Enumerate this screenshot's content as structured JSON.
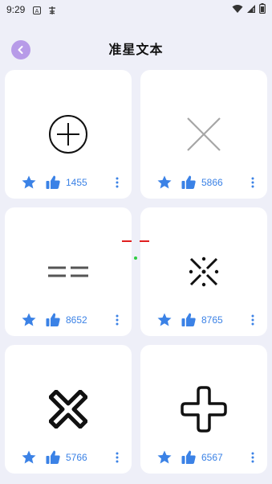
{
  "status_bar": {
    "time": "9:29"
  },
  "header": {
    "title": "准星文本"
  },
  "colors": {
    "accent": "#3b82e6",
    "back": "#b79be8",
    "bg": "#eeeff8"
  },
  "cards": [
    {
      "icon": "circle-plus-crosshair",
      "likes": "1455"
    },
    {
      "icon": "x-crosshair",
      "likes": "5866"
    },
    {
      "icon": "double-dash-crosshair",
      "likes": "8652"
    },
    {
      "icon": "dot-x-crosshair",
      "likes": "8765"
    },
    {
      "icon": "bold-x-crosshair",
      "likes": "5766"
    },
    {
      "icon": "outline-plus-crosshair",
      "likes": "6567"
    }
  ]
}
